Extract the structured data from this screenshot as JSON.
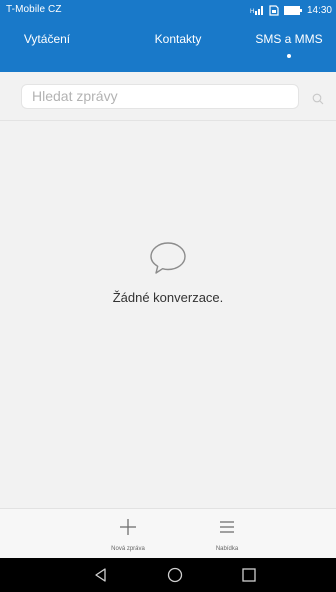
{
  "status_bar": {
    "carrier": "T-Mobile CZ",
    "time": "14:30",
    "icons": [
      "signal-icon",
      "sim-card-icon",
      "battery-icon"
    ]
  },
  "tabs": [
    {
      "label": "Vytáčení",
      "active": false
    },
    {
      "label": "Kontakty",
      "active": false
    },
    {
      "label": "SMS a MMS",
      "active": true
    }
  ],
  "search": {
    "placeholder": "Hledat zprávy",
    "icon": "search-icon"
  },
  "empty_state": {
    "icon": "chat-bubble-icon",
    "text": "Žádné konverzace."
  },
  "bottom_bar": {
    "items": [
      {
        "label": "Nová zpráva",
        "icon": "plus-icon"
      },
      {
        "label": "Nabídka",
        "icon": "menu-icon"
      }
    ]
  },
  "nav_bar": {
    "icons": [
      "back-icon",
      "home-icon",
      "recents-icon"
    ]
  },
  "colors": {
    "header": "#1979c9",
    "background": "#f2f2f2",
    "nav_bar": "#000000"
  }
}
